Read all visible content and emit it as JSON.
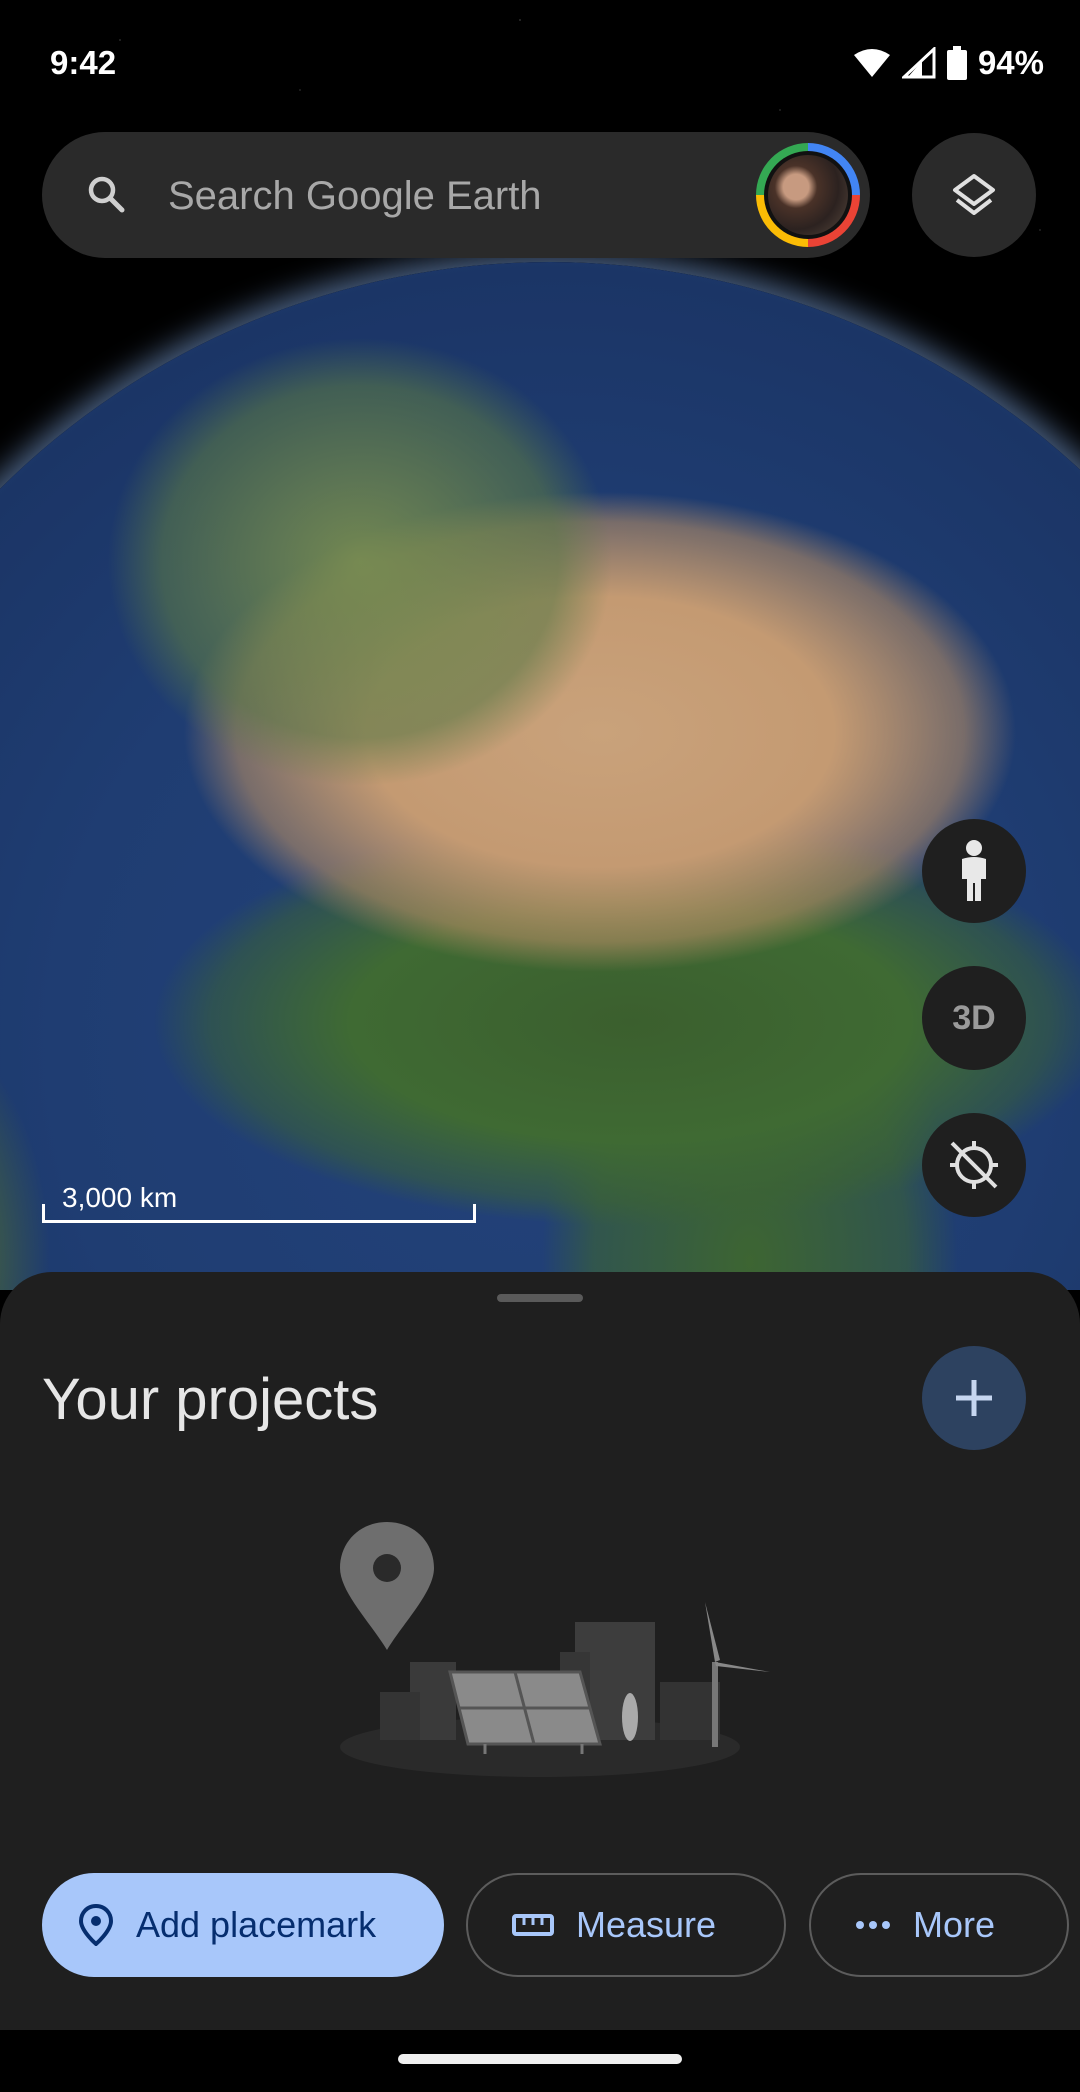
{
  "status_bar": {
    "time": "9:42",
    "battery": "94%"
  },
  "search": {
    "placeholder": "Search Google Earth"
  },
  "map": {
    "scale_label": "3,000 km",
    "three_d_label": "3D"
  },
  "projects": {
    "title": "Your projects"
  },
  "actions": {
    "add_placemark": "Add placemark",
    "measure": "Measure",
    "more": "More"
  },
  "colors": {
    "primary_chip": "#a8c7fa",
    "sheet_bg": "#1f1f1f",
    "add_button_bg": "#2d4260"
  },
  "icons": [
    "search-icon",
    "layers-icon",
    "pegman-icon",
    "compass-reset-icon",
    "plus-icon",
    "location-pin-icon",
    "ruler-icon",
    "more-horizontal-icon",
    "wifi-icon",
    "signal-icon",
    "battery-icon"
  ]
}
